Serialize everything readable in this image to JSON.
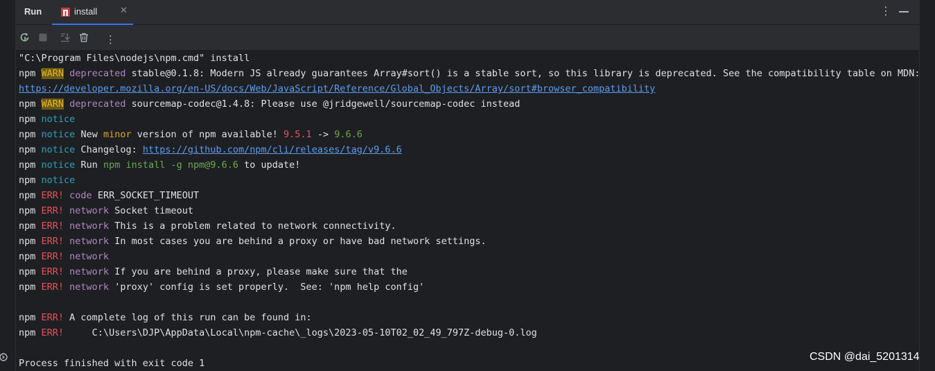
{
  "run_panel": {
    "title": "Run",
    "tab": {
      "label": "install",
      "close_glyph": "✕",
      "icon": "npm-icon"
    },
    "header_actions": [
      "more-icon",
      "minimize-icon"
    ],
    "toolbar": [
      "rerun-icon",
      "stop-icon",
      "scroll-to-end-icon",
      "clear-all-icon",
      "more-icon"
    ]
  },
  "console": {
    "cmd": "\"C:\\Program Files\\nodejs\\npm.cmd\" install",
    "prefix": "npm",
    "warn_tag": "WARN",
    "deprecated": "deprecated",
    "warn1_text": " stable@0.1.8: Modern JS already guarantees Array#sort() is a stable sort, so this library is deprecated. See the compatibility table on MDN:",
    "warn1_link": "https://developer.mozilla.org/en-US/docs/Web/JavaScript/Reference/Global_Objects/Array/sort#browser_compatibility",
    "warn2_text": " sourcemap-codec@1.4.8: Please use @jridgewell/sourcemap-codec instead",
    "notice_tag": "notice",
    "notice_new_a": " New ",
    "notice_minor": "minor",
    "notice_new_b": " version of npm available! ",
    "version_old": "9.5.1",
    "arrow": " -> ",
    "version_new": "9.6.6",
    "changelog_label": " Changelog: ",
    "changelog_link": "https://github.com/npm/cli/releases/tag/v9.6.6",
    "run_label": " Run ",
    "run_cmd": "npm install -g npm@9.6.6",
    "run_tail": " to update!",
    "err_tag": "ERR!",
    "code_label": " code",
    "code_value": " ERR_SOCKET_TIMEOUT",
    "network_label": " network",
    "net1": " Socket timeout",
    "net2": " This is a problem related to network connectivity.",
    "net3": " In most cases you are behind a proxy or have bad network settings.",
    "net5": " If you are behind a proxy, please make sure that the",
    "net6": " 'proxy' config is set properly.  See: 'npm help config'",
    "log_line": " A complete log of this run can be found in:",
    "log_path": "     C:\\Users\\DJP\\AppData\\Local\\npm-cache\\_logs\\2023-05-10T02_02_49_797Z-debug-0.log",
    "exit_line": "Process finished with exit code 1"
  },
  "watermark": "CSDN @dai_5201314",
  "colors": {
    "panel_bg": "#2b2d30",
    "console_bg": "#1e1f22",
    "accent": "#3574f0",
    "warn_bg": "#6b5b13",
    "err": "#e8515b",
    "notice": "#2aa3bd",
    "link": "#5a9df0"
  }
}
